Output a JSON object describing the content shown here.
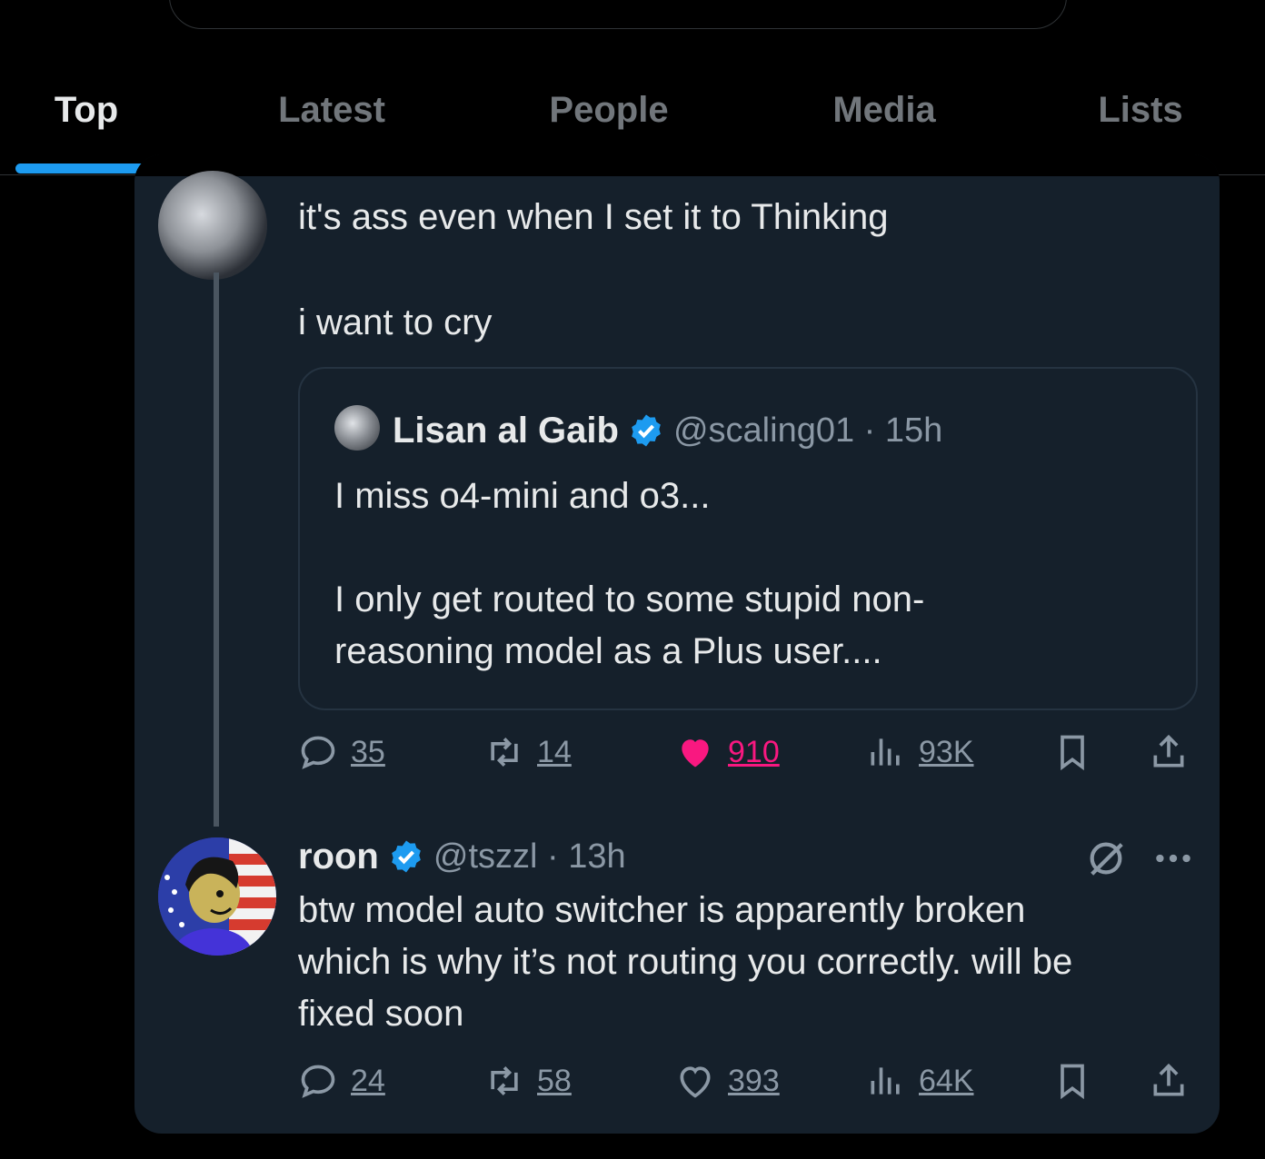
{
  "tabs": [
    {
      "label": "Top",
      "active": true
    },
    {
      "label": "Latest",
      "active": false
    },
    {
      "label": "People",
      "active": false
    },
    {
      "label": "Media",
      "active": false
    },
    {
      "label": "Lists",
      "active": false
    }
  ],
  "colors": {
    "accent": "#1d9bf0",
    "like": "#f91880",
    "verified": "#1d9bf0",
    "card_bg": "#15202b"
  },
  "tweet1": {
    "text": "it's ass even when I set it to Thinking\n\ni want to cry",
    "quote": {
      "name": "Lisan al Gaib",
      "handle_time": "@scaling01 · 15h",
      "text": "I miss o4-mini and o3...\n\nI only get routed to some stupid non-\nreasoning model as a Plus user...."
    },
    "actions": {
      "replies": "35",
      "reposts": "14",
      "likes": "910",
      "views": "93K",
      "liked": true
    }
  },
  "tweet2": {
    "name": "roon",
    "handle_time": "@tszzl · 13h",
    "text": "btw model auto switcher is apparently broken\nwhich is why it’s not routing you correctly. will be\nfixed soon",
    "actions": {
      "replies": "24",
      "reposts": "58",
      "likes": "393",
      "views": "64K",
      "liked": false
    }
  },
  "icons": [
    "reply-icon",
    "repost-icon",
    "like-icon",
    "views-icon",
    "bookmark-icon",
    "share-icon",
    "verified-icon",
    "grok-icon",
    "more-icon"
  ]
}
